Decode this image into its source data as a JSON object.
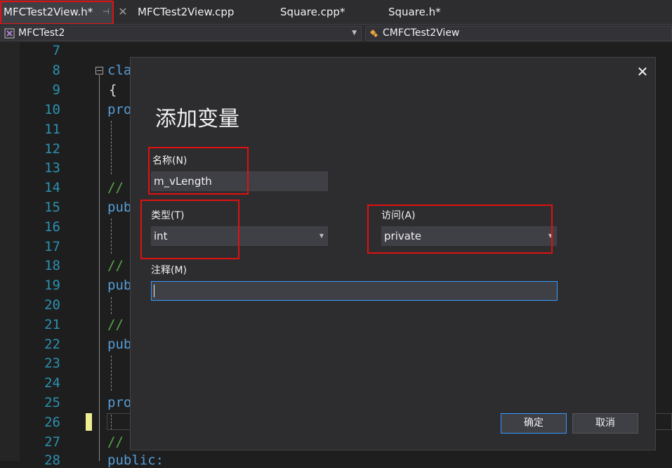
{
  "tabs": [
    {
      "label": "MFCTest2View.h*",
      "active": true
    },
    {
      "label": "MFCTest2View.cpp",
      "active": false
    },
    {
      "label": "Square.cpp*",
      "active": false
    },
    {
      "label": "Square.h*",
      "active": false
    }
  ],
  "tab_pin_glyph": "⊣",
  "tab_close_glyph": "✕",
  "navbar": {
    "project": "MFCTest2",
    "class": "CMFCTest2View"
  },
  "editor": {
    "line_numbers": [
      "7",
      "8",
      "9",
      "10",
      "11",
      "12",
      "13",
      "14",
      "15",
      "16",
      "17",
      "18",
      "19",
      "20",
      "21",
      "22",
      "23",
      "24",
      "25",
      "26",
      "27",
      "28"
    ],
    "code": {
      "l8": "cla",
      "l9": "{",
      "l10": "pro",
      "l14": "//",
      "l15": "pub",
      "l18": "//",
      "l19": "pub",
      "l21": "//",
      "l22": "pub",
      "l25": "pro",
      "l27": "//",
      "l28": "public:"
    }
  },
  "dialog": {
    "title": "添加变量",
    "close_glyph": "✕",
    "name_label": "名称(N)",
    "name_value": "m_vLength",
    "type_label": "类型(T)",
    "type_value": "int",
    "access_label": "访问(A)",
    "access_value": "private",
    "comment_label": "注释(M)",
    "comment_value": "",
    "ok_label": "确定",
    "cancel_label": "取消"
  },
  "colors": {
    "highlight_box": "#e01010",
    "keyword": "#569cd6",
    "comment": "#57a64a",
    "line_number": "#2b91af",
    "focus_border": "#3399ff"
  }
}
